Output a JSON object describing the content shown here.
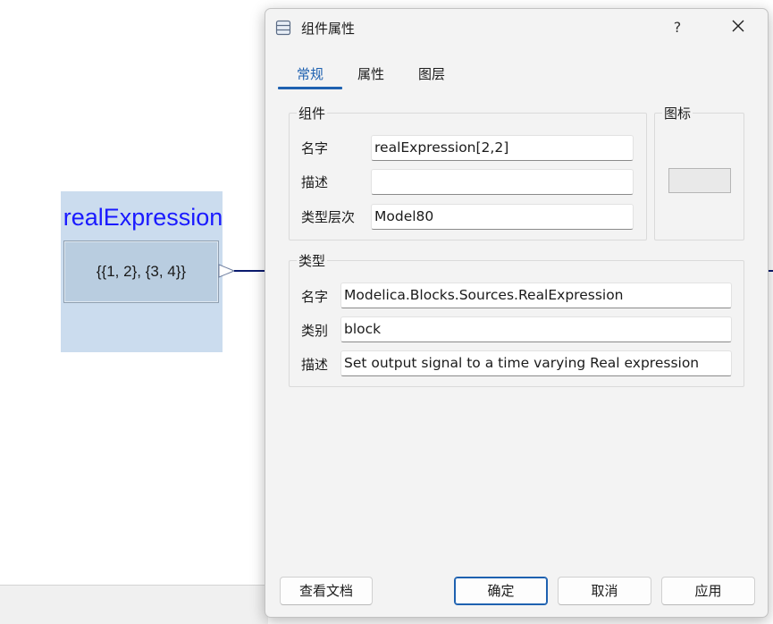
{
  "canvas": {
    "block": {
      "title": "realExpression",
      "value_text": "{{1, 2}, {3, 4}}"
    }
  },
  "dialog": {
    "title": "组件属性",
    "help_label": "?",
    "tabs": [
      {
        "label": "常规",
        "active": true
      },
      {
        "label": "属性",
        "active": false
      },
      {
        "label": "图层",
        "active": false
      }
    ],
    "component_group": {
      "legend": "组件",
      "name_label": "名字",
      "name_value": "realExpression[2,2]",
      "description_label": "描述",
      "description_value": "",
      "type_hierarchy_label": "类型层次",
      "type_hierarchy_value": "Model80"
    },
    "icon_group": {
      "legend": "图标"
    },
    "type_group": {
      "legend": "类型",
      "name_label": "名字",
      "name_value": "Modelica.Blocks.Sources.RealExpression",
      "category_label": "类别",
      "category_value": "block",
      "description_label": "描述",
      "description_value": "Set output signal to a time varying Real expression"
    },
    "buttons": {
      "view_docs": "查看文档",
      "ok": "确定",
      "cancel": "取消",
      "apply": "应用"
    }
  },
  "colors": {
    "accent": "#1e61b0",
    "block_title": "#1a1aff",
    "selection": "#cbdcee",
    "connector": "#0a1a6e"
  }
}
